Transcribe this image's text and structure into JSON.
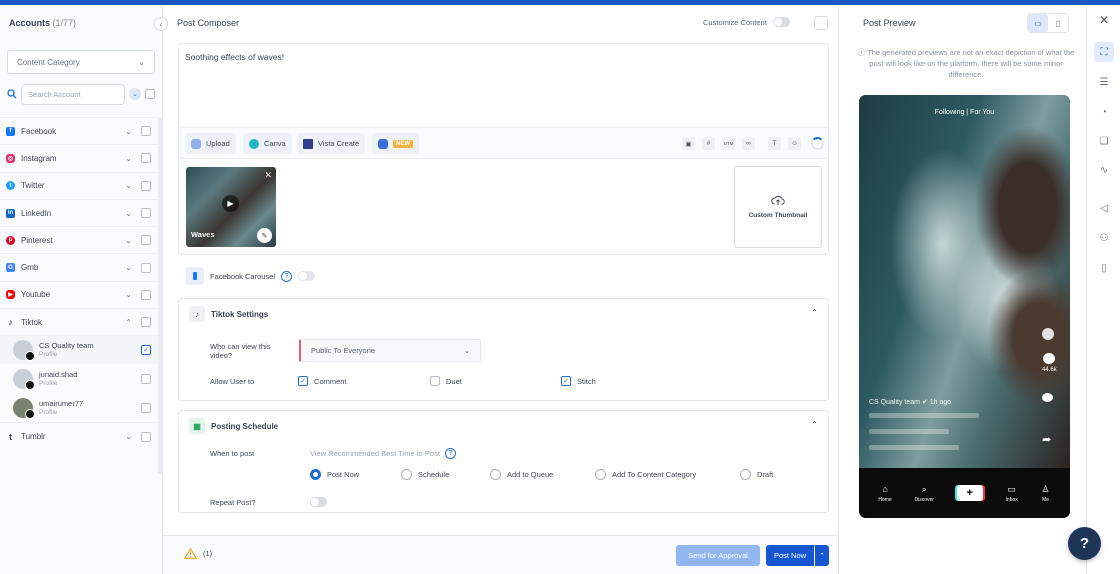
{
  "accounts_panel": {
    "title": "Accounts",
    "count": "(1/77)",
    "category_dropdown": "Content Category",
    "search_placeholder": "Search Account",
    "networks": [
      {
        "label": "Facebook",
        "color": "#1877f2",
        "expanded": false
      },
      {
        "label": "Instagram",
        "color": "#e1306c",
        "expanded": false
      },
      {
        "label": "Twitter",
        "color": "#1da1f2",
        "expanded": false
      },
      {
        "label": "LinkedIn",
        "color": "#0a66c2",
        "expanded": false
      },
      {
        "label": "Pinterest",
        "color": "#e60023",
        "expanded": false
      },
      {
        "label": "Gmb",
        "color": "#4285f4",
        "expanded": false
      },
      {
        "label": "Youtube",
        "color": "#ff0000",
        "expanded": false
      },
      {
        "label": "Tiktok",
        "color": "#000000",
        "expanded": true
      }
    ],
    "tiktok_accounts": [
      {
        "name": "CS Quality team",
        "sub": "Profile",
        "checked": true
      },
      {
        "name": "junaid.shad",
        "sub": "Profile",
        "checked": false
      },
      {
        "name": "umairumer77",
        "sub": "Profile",
        "checked": false
      }
    ],
    "last_network": {
      "label": "Tumblr",
      "color": "#35465c"
    }
  },
  "composer": {
    "title": "Post Composer",
    "customize_label": "Customize Content",
    "text": "Soothing effects of waves!",
    "tools": {
      "upload": "Upload",
      "canva": "Canva",
      "vista": "Vista Create",
      "new_badge": "NEW",
      "utm": "UTM"
    },
    "media": {
      "label": "Waves",
      "custom_thumbnail": "Custom Thumbnail"
    },
    "facebook_carousel": "Facebook Carousel",
    "tiktok_settings": {
      "title": "Tiktok Settings",
      "who_label": "Who can view this video?",
      "who_value": "Public To Everyone",
      "allow_label": "Allow User to",
      "options": [
        {
          "label": "Comment",
          "checked": true
        },
        {
          "label": "Duet",
          "checked": false
        },
        {
          "label": "Stitch",
          "checked": true
        }
      ]
    },
    "schedule": {
      "title": "Posting Schedule",
      "when_label": "When to post",
      "best_time_link": "View Recommended Best Time to Post",
      "options": [
        {
          "label": "Post Now",
          "selected": true
        },
        {
          "label": "Schedule",
          "selected": false
        },
        {
          "label": "Add to Queue",
          "selected": false
        },
        {
          "label": "Add To Content Category",
          "selected": false
        },
        {
          "label": "Draft",
          "selected": false
        }
      ],
      "repeat_label": "Repeat Post?"
    },
    "footer": {
      "warning_count": "(1)",
      "send_approval": "Send for Approval",
      "post_now": "Post Now"
    }
  },
  "preview": {
    "title": "Post Preview",
    "note": "The generated previews are not an exact depiction of what the post will look like on the platform, there will be some minor difference.",
    "tiktok_tabs": "Following | For You",
    "likes": "44.6k",
    "caption_account": "CS Quality team",
    "caption_time": "1h ago",
    "nav": [
      "Home",
      "Discover",
      "Inbox",
      "Me"
    ]
  },
  "help_button": "?"
}
